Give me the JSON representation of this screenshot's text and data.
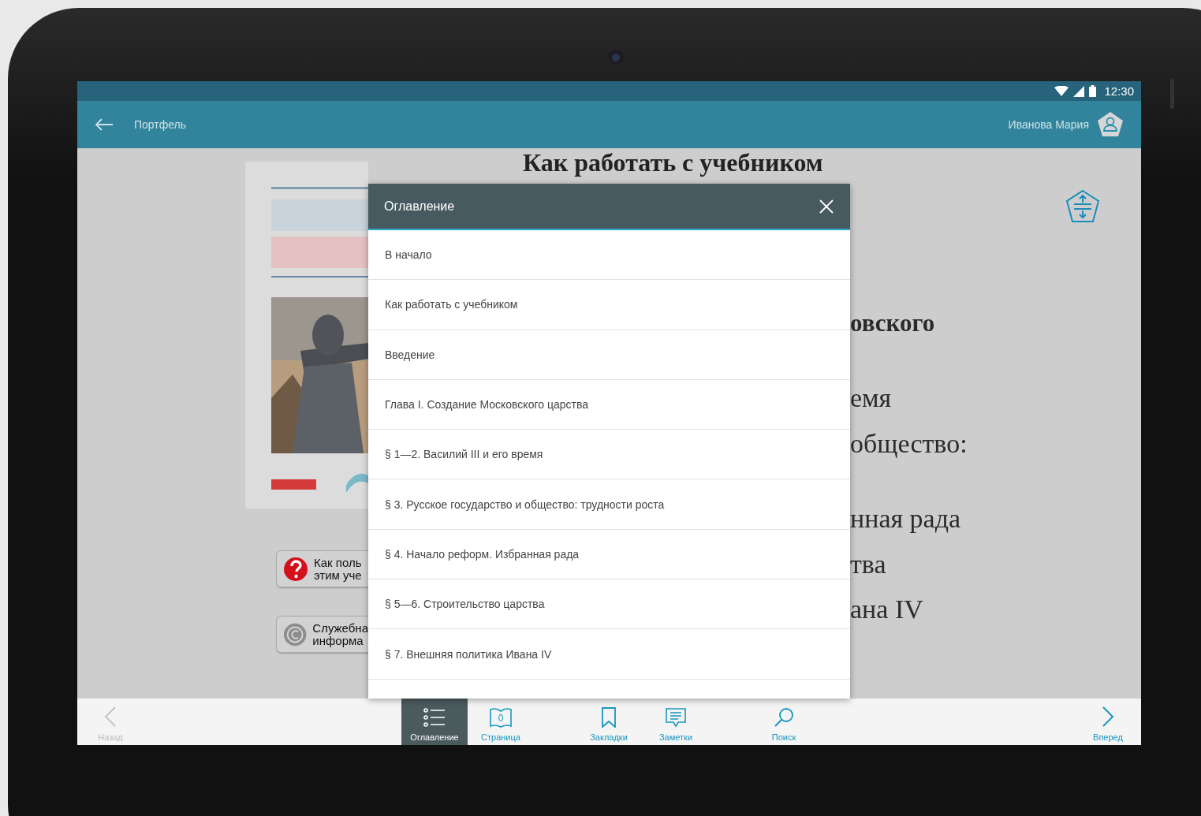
{
  "status_bar": {
    "time": "12:30"
  },
  "app_bar": {
    "back_label": "Портфель",
    "user_name": "Иванова Мария"
  },
  "page": {
    "title": "Как работать с учебником",
    "buttons": [
      {
        "kind": "help",
        "lines": [
          "Как поль",
          "этим уче"
        ]
      },
      {
        "kind": "info",
        "lines": [
          "Служебна",
          "информа"
        ]
      }
    ],
    "fragments": [
      {
        "text": "овского",
        "bold": true
      },
      {
        "text": "емя",
        "bold": false
      },
      {
        "text": "общество:",
        "bold": false
      },
      {
        "text": "нная рада",
        "bold": false
      },
      {
        "text": "тва",
        "bold": false
      },
      {
        "text": "ана IV",
        "bold": false
      }
    ]
  },
  "toc_dialog": {
    "title": "Оглавление",
    "items": [
      "В начало",
      "Как работать с учебником",
      "Введение",
      "Глава I. Создание Московского царства",
      "§ 1—2. Василий III и его время",
      "§ 3. Русское государство и общество: трудности роста",
      "§ 4. Начало реформ. Избранная рада",
      "§ 5—6. Строительство царства",
      "§ 7. Внешняя политика Ивана IV"
    ]
  },
  "bottom_bar": [
    {
      "kind": "back",
      "label": "Назад",
      "selected": false,
      "disabled": true
    },
    {
      "kind": "contents",
      "label": "Оглавление",
      "selected": true,
      "disabled": false
    },
    {
      "kind": "page",
      "label": "Страница",
      "page_number": "0",
      "selected": false,
      "disabled": false
    },
    {
      "kind": "bookmarks",
      "label": "Закладки",
      "selected": false,
      "disabled": false
    },
    {
      "kind": "notes",
      "label": "Заметки",
      "selected": false,
      "disabled": false
    },
    {
      "kind": "search",
      "label": "Поиск",
      "selected": false,
      "disabled": false
    },
    {
      "kind": "forward",
      "label": "Вперед",
      "selected": false,
      "disabled": false
    }
  ]
}
